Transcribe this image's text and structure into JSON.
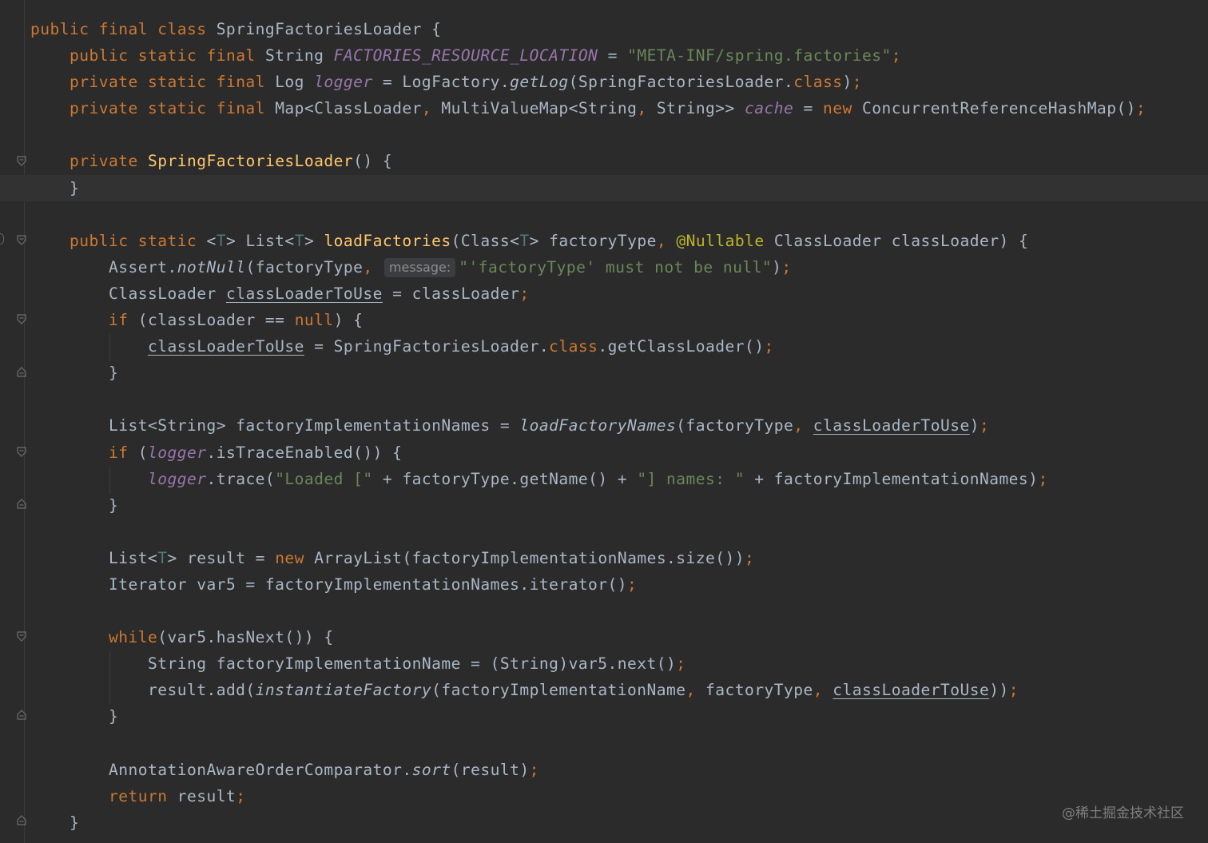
{
  "code": {
    "class_decl": {
      "kw": "public final class ",
      "name": "SpringFactoriesLoader",
      "rest": " {"
    },
    "line2": {
      "kw": "public static final ",
      "type": "String ",
      "field": "FACTORIES_RESOURCE_LOCATION",
      "eq": " = ",
      "str": "\"META-INF/spring.factories\"",
      "semi": ";"
    },
    "line3": {
      "kw": "private static final ",
      "type": "Log ",
      "field": "logger",
      "eq": " = LogFactory.",
      "call": "getLog",
      "arg": "(SpringFactoriesLoader.",
      "kwclass": "class",
      "end": ")",
      "semi": ";"
    },
    "line4": {
      "kw": "private static final ",
      "type1": "Map<ClassLoader",
      "comma1": ", ",
      "type2": "MultiValueMap<String",
      "comma2": ", ",
      "type3": "String>> ",
      "field": "cache",
      "eq": " = ",
      "new": "new ",
      "ctor": "ConcurrentReferenceHashMap()",
      "semi": ";"
    },
    "line6": {
      "kw": "private ",
      "name": "SpringFactoriesLoader",
      "rest": "() {"
    },
    "line7": {
      "text": "}"
    },
    "line9": {
      "kw": "public static ",
      "lt": "<",
      "t": "T",
      "gt": "> List<",
      "t2": "T",
      "gt2": "> ",
      "name": "loadFactories",
      "p1": "(Class<",
      "t3": "T",
      "p2": "> factoryType",
      "comma": ", ",
      "ann": "@Nullable",
      "p3": " ClassLoader classLoader) {"
    },
    "line10": {
      "a": "Assert.",
      "call": "notNull",
      "b": "(factoryType",
      "comma": ",",
      "hint": "message:",
      "str": "\"'factoryType' must not be null\"",
      "end": ")",
      "semi": ";"
    },
    "line11": {
      "a": "ClassLoader ",
      "var": "classLoaderToUse",
      "b": " = classLoader",
      "semi": ";"
    },
    "line12": {
      "kw": "if",
      "a": " (classLoader == ",
      "null": "null",
      "b": ") {"
    },
    "line13": {
      "var": "classLoaderToUse",
      "a": " = SpringFactoriesLoader.",
      "kw": "class",
      "b": ".getClassLoader()",
      "semi": ";"
    },
    "line14": {
      "text": "}"
    },
    "line16": {
      "a": "List<String> factoryImplementationNames = ",
      "call": "loadFactoryNames",
      "b": "(factoryType",
      "comma": ", ",
      "var": "classLoaderToUse",
      "c": ")",
      "semi": ";"
    },
    "line17": {
      "kw": "if",
      "a": " (",
      "field": "logger",
      "b": ".isTraceEnabled()) {"
    },
    "line18": {
      "field": "logger",
      "a": ".trace(",
      "str1": "\"Loaded [\"",
      "b": " + factoryType.getName() + ",
      "str2": "\"] names: \"",
      "c": " + factoryImplementationNames)",
      "semi": ";"
    },
    "line19": {
      "text": "}"
    },
    "line21": {
      "a": "List<",
      "t": "T",
      "b": "> result = ",
      "new": "new ",
      "c": "ArrayList(factoryImplementationNames.size())",
      "semi": ";"
    },
    "line22": {
      "a": "Iterator var5 = factoryImplementationNames.iterator()",
      "semi": ";"
    },
    "line24": {
      "kw": "while",
      "a": "(var5.hasNext()) {"
    },
    "line25": {
      "a": "String factoryImplementationName = (String)var5.next()",
      "semi": ";"
    },
    "line26": {
      "a": "result.add(",
      "call": "instantiateFactory",
      "b": "(factoryImplementationName",
      "comma1": ", ",
      "c": "factoryType",
      "comma2": ", ",
      "var": "classLoaderToUse",
      "d": "))",
      "semi": ";"
    },
    "line27": {
      "text": "}"
    },
    "line29": {
      "a": "AnnotationAwareOrderComparator.",
      "call": "sort",
      "b": "(result)",
      "semi": ";"
    },
    "line30": {
      "kw": "return",
      "a": " result",
      "semi": ";"
    },
    "line31": {
      "text": "}"
    }
  },
  "watermark": "@稀土掘金技术社区",
  "colors": {
    "background": "#2b2b2b",
    "keyword": "#cc7832",
    "string": "#6a8759",
    "method_decl": "#ffc66d",
    "field": "#9876aa",
    "default_text": "#a9b7c6",
    "annotation": "#bbb529",
    "type_param": "#507874"
  },
  "gutter_icons": [
    "fold-start-icon",
    "fold-end-icon"
  ]
}
